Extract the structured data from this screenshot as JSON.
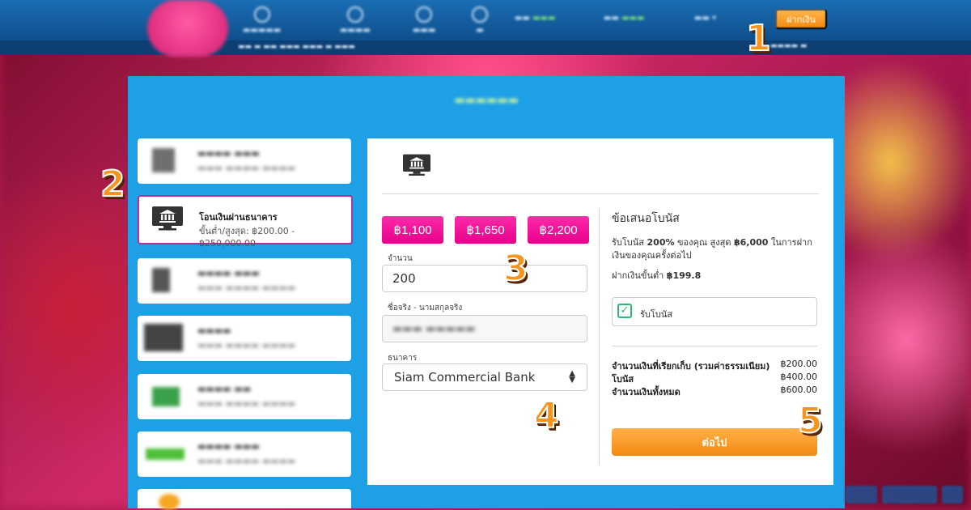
{
  "header": {
    "deposit_label": "ฝากเงิน"
  },
  "form": {
    "selected_method": {
      "name": "โอนเงินผ่านธนาคาร",
      "range": "ขั้นต่ำ/สูงสุด: ฿200.00 - ฿250,000.00"
    },
    "quick_amounts": [
      "฿1,100",
      "฿1,650",
      "฿2,200"
    ],
    "amount_label": "จำนวน",
    "amount_value": "200",
    "name_label": "ชื่อจริง - นามสกุลจริง",
    "bank_label": "ธนาคาร",
    "bank_value": "Siam Commercial Bank"
  },
  "bonus": {
    "title": "ข้อเสนอโบนัส",
    "description_pre": "รับโบนัส ",
    "description_pct": "200%",
    "description_mid": " ของคุณ สูงสุด ",
    "description_max": "฿6,000",
    "description_post": " ในการฝากเงินของคุณครั้งต่อไป",
    "min_label": "ฝากเงินขั้นต่ำ ",
    "min_value": "฿199.8",
    "checkbox_label": "รับโบนัส",
    "checked": true
  },
  "summary": [
    {
      "label": "จำนวนเงินที่เรียกเก็บ (รวมค่าธรรมเนียม)",
      "value": "฿200.00"
    },
    {
      "label": "โบนัส",
      "value": "฿400.00"
    },
    {
      "label": "จำนวนเงินทั้งหมด",
      "value": "฿600.00"
    }
  ],
  "next_label": "ต่อไป",
  "steps": [
    "1",
    "2",
    "3",
    "4",
    "5"
  ],
  "colors": {
    "panel": "#1ea0e6",
    "accent_pink": "#e6008c",
    "accent_orange": "#f28a10",
    "check_green": "#2bb673",
    "active_border": "#b7309a"
  }
}
